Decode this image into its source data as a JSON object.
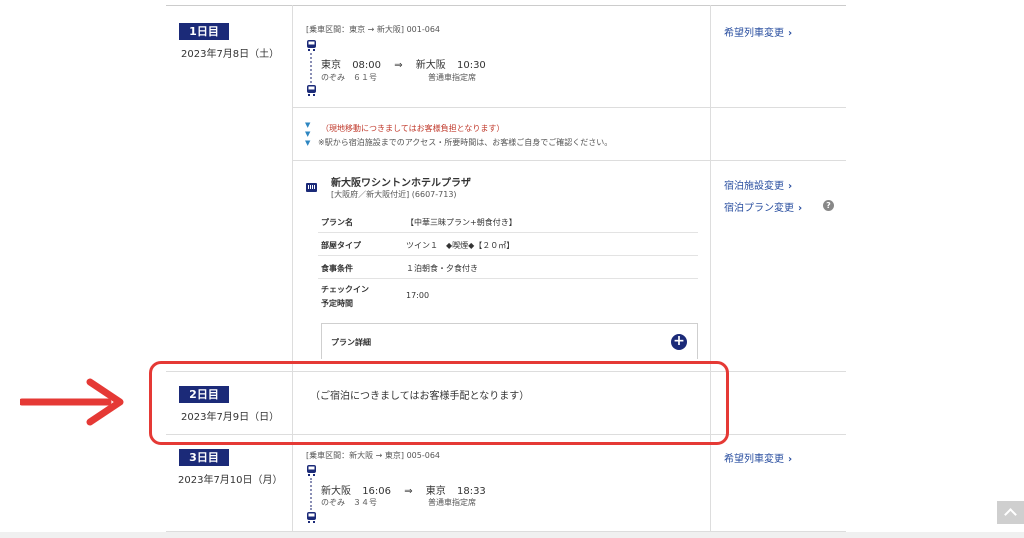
{
  "day1": {
    "badge": "1日目",
    "date": "2023年7月8日（土）",
    "train": {
      "section": "[乗車区間：東京 → 新大阪] 001-064",
      "from": "東京",
      "dep_time": "08:00",
      "arrow": "⇒",
      "to": "新大阪",
      "arr_time": "10:30",
      "train_name": "のぞみ　６１号",
      "seat": "普通車指定席"
    },
    "change_train_link": "希望列車変更",
    "notice": {
      "red": "（現地移動につきましてはお客様負担となります）",
      "note": "※駅から宿泊施設までのアクセス・所要時間は、お客様ご自身でご確認ください。"
    },
    "hotel": {
      "name": "新大阪ワシントンホテルプラザ",
      "area": "[大阪府／新大阪付近] (6607-713)",
      "rows": [
        {
          "label": "プラン名",
          "value": "【中華三昧プラン+朝食付き】"
        },
        {
          "label": "部屋タイプ",
          "value": "ツイン１　◆喫煙◆【２０㎡】"
        },
        {
          "label": "食事条件",
          "value": "１泊朝食・夕食付き"
        },
        {
          "label": "チェックイン",
          "label2": "予定時間",
          "value": "17:00"
        }
      ],
      "plan_detail": "プラン詳細"
    },
    "change_hotel_link": "宿泊施設変更",
    "change_plan_link": "宿泊プラン変更"
  },
  "day2": {
    "badge": "2日目",
    "date": "2023年7月9日（日）",
    "message": "（ご宿泊につきましてはお客様手配となります）"
  },
  "day3": {
    "badge": "3日目",
    "date": "2023年7月10日（月）",
    "train": {
      "section": "[乗車区間：新大阪 → 東京] 005-064",
      "from": "新大阪",
      "dep_time": "16:06",
      "arrow": "⇒",
      "to": "東京",
      "arr_time": "18:33",
      "train_name": "のぞみ　３４号",
      "seat": "普通車指定席"
    },
    "change_train_link": "希望列車変更"
  },
  "icons": {
    "chevron": "›",
    "plus": "+",
    "help": "?"
  },
  "colors": {
    "badge": "#1b2a78",
    "link": "#2a4fa0",
    "highlight": "#e53935",
    "notice": "#c0392b"
  }
}
